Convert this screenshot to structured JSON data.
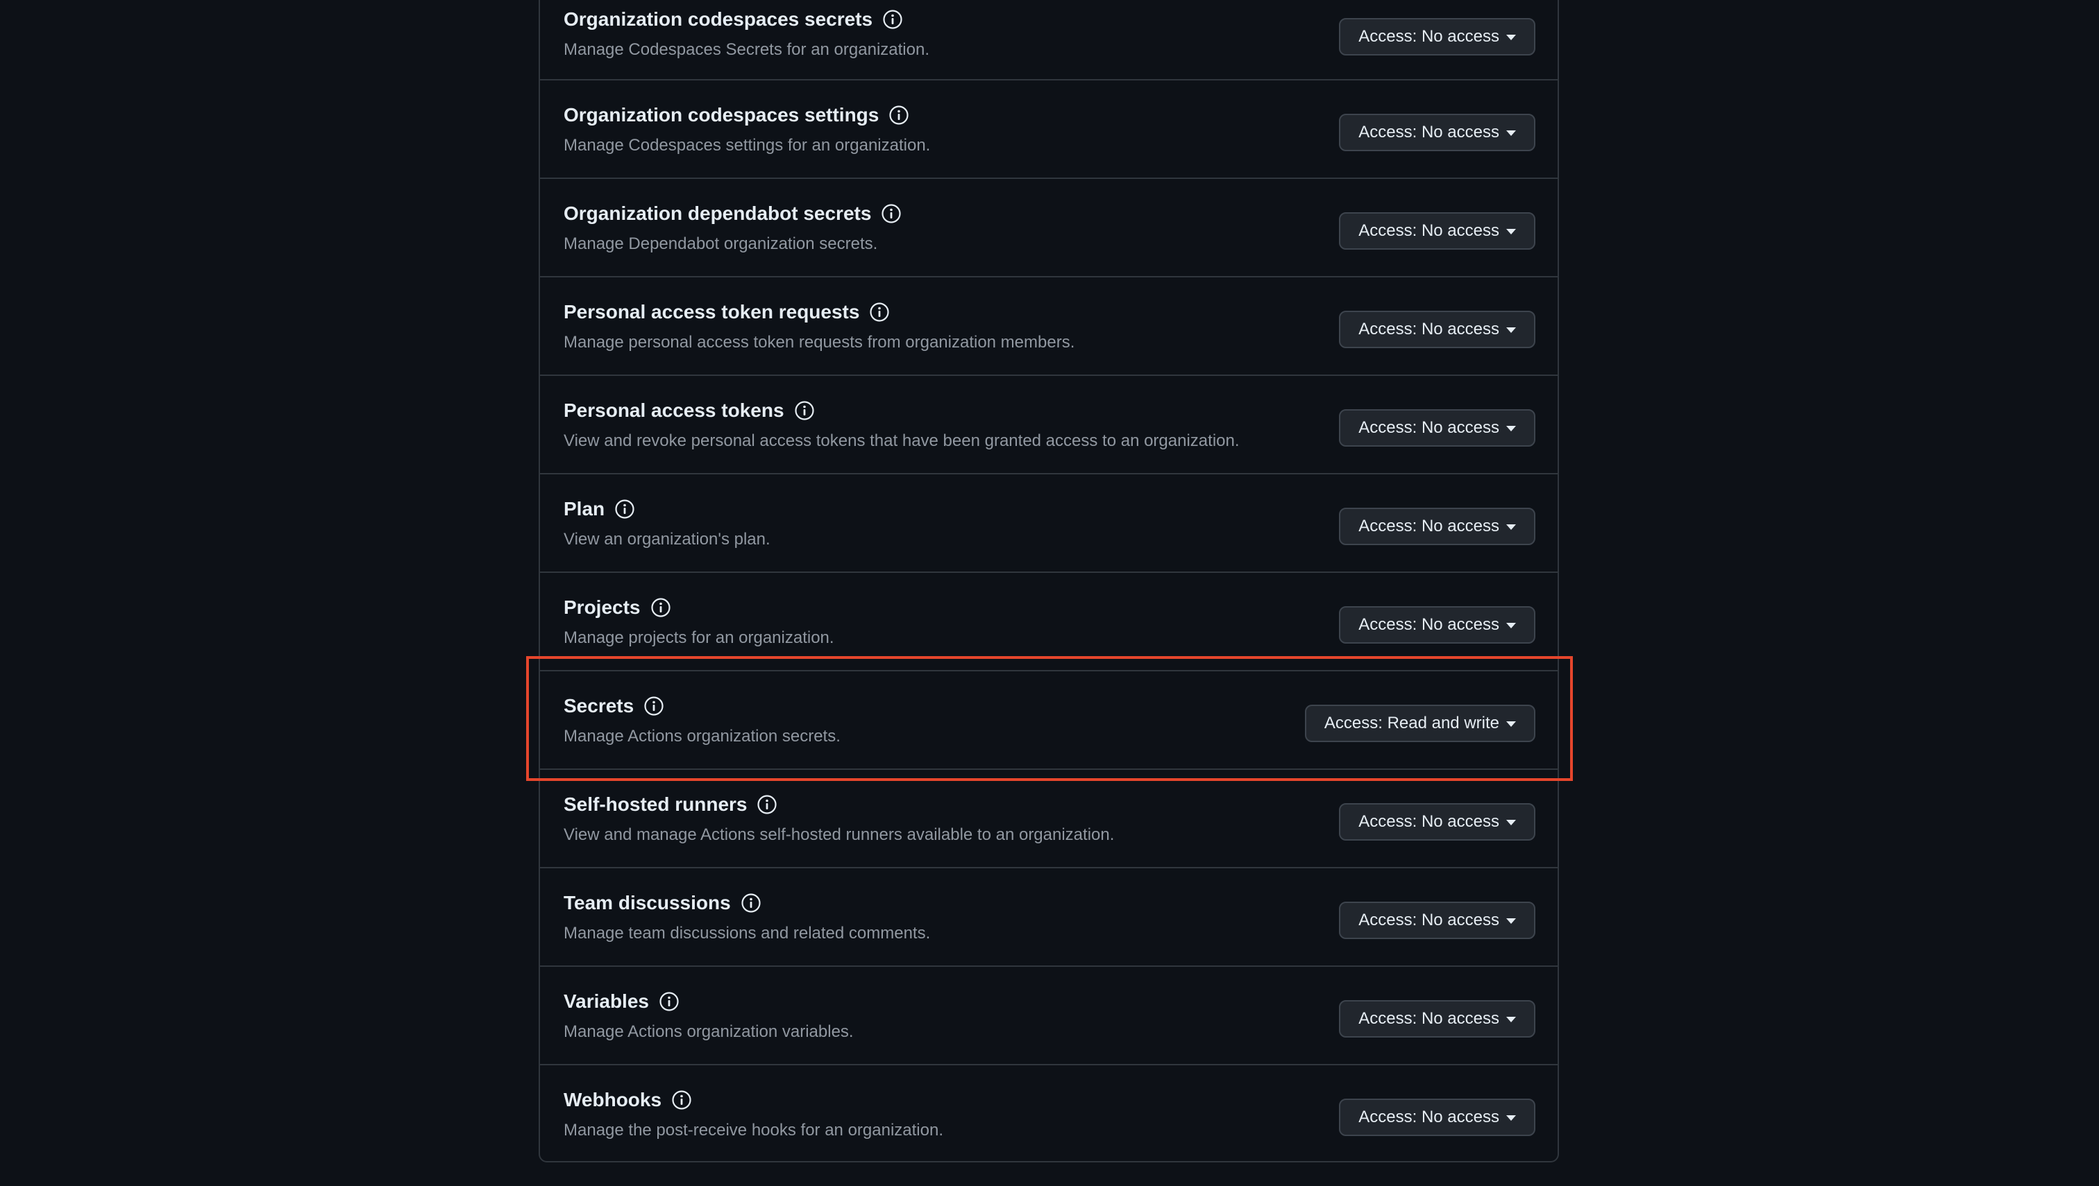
{
  "colors": {
    "background": "#0d1117",
    "border": "#30363d",
    "title": "#e6edf3",
    "description": "#9198a1",
    "button_bg": "#21262d",
    "highlight": "#e5462c"
  },
  "permissions": [
    {
      "title": "Organization codespaces secrets",
      "description": "Manage Codespaces Secrets for an organization.",
      "access": "Access: No access",
      "icon": "info-icon"
    },
    {
      "title": "Organization codespaces settings",
      "description": "Manage Codespaces settings for an organization.",
      "access": "Access: No access",
      "icon": "info-icon"
    },
    {
      "title": "Organization dependabot secrets",
      "description": "Manage Dependabot organization secrets.",
      "access": "Access: No access",
      "icon": "info-icon"
    },
    {
      "title": "Personal access token requests",
      "description": "Manage personal access token requests from organization members.",
      "access": "Access: No access",
      "icon": "info-icon"
    },
    {
      "title": "Personal access tokens",
      "description": "View and revoke personal access tokens that have been granted access to an organization.",
      "access": "Access: No access",
      "icon": "info-icon"
    },
    {
      "title": "Plan",
      "description": "View an organization's plan.",
      "access": "Access: No access",
      "icon": "info-icon"
    },
    {
      "title": "Projects",
      "description": "Manage projects for an organization.",
      "access": "Access: No access",
      "icon": "info-icon"
    },
    {
      "title": "Secrets",
      "description": "Manage Actions organization secrets.",
      "access": "Access: Read and write",
      "icon": "info-icon",
      "highlighted": true
    },
    {
      "title": "Self-hosted runners",
      "description": "View and manage Actions self-hosted runners available to an organization.",
      "access": "Access: No access",
      "icon": "info-icon"
    },
    {
      "title": "Team discussions",
      "description": "Manage team discussions and related comments.",
      "access": "Access: No access",
      "icon": "info-icon"
    },
    {
      "title": "Variables",
      "description": "Manage Actions organization variables.",
      "access": "Access: No access",
      "icon": "info-icon"
    },
    {
      "title": "Webhooks",
      "description": "Manage the post-receive hooks for an organization.",
      "access": "Access: No access",
      "icon": "info-icon"
    }
  ]
}
